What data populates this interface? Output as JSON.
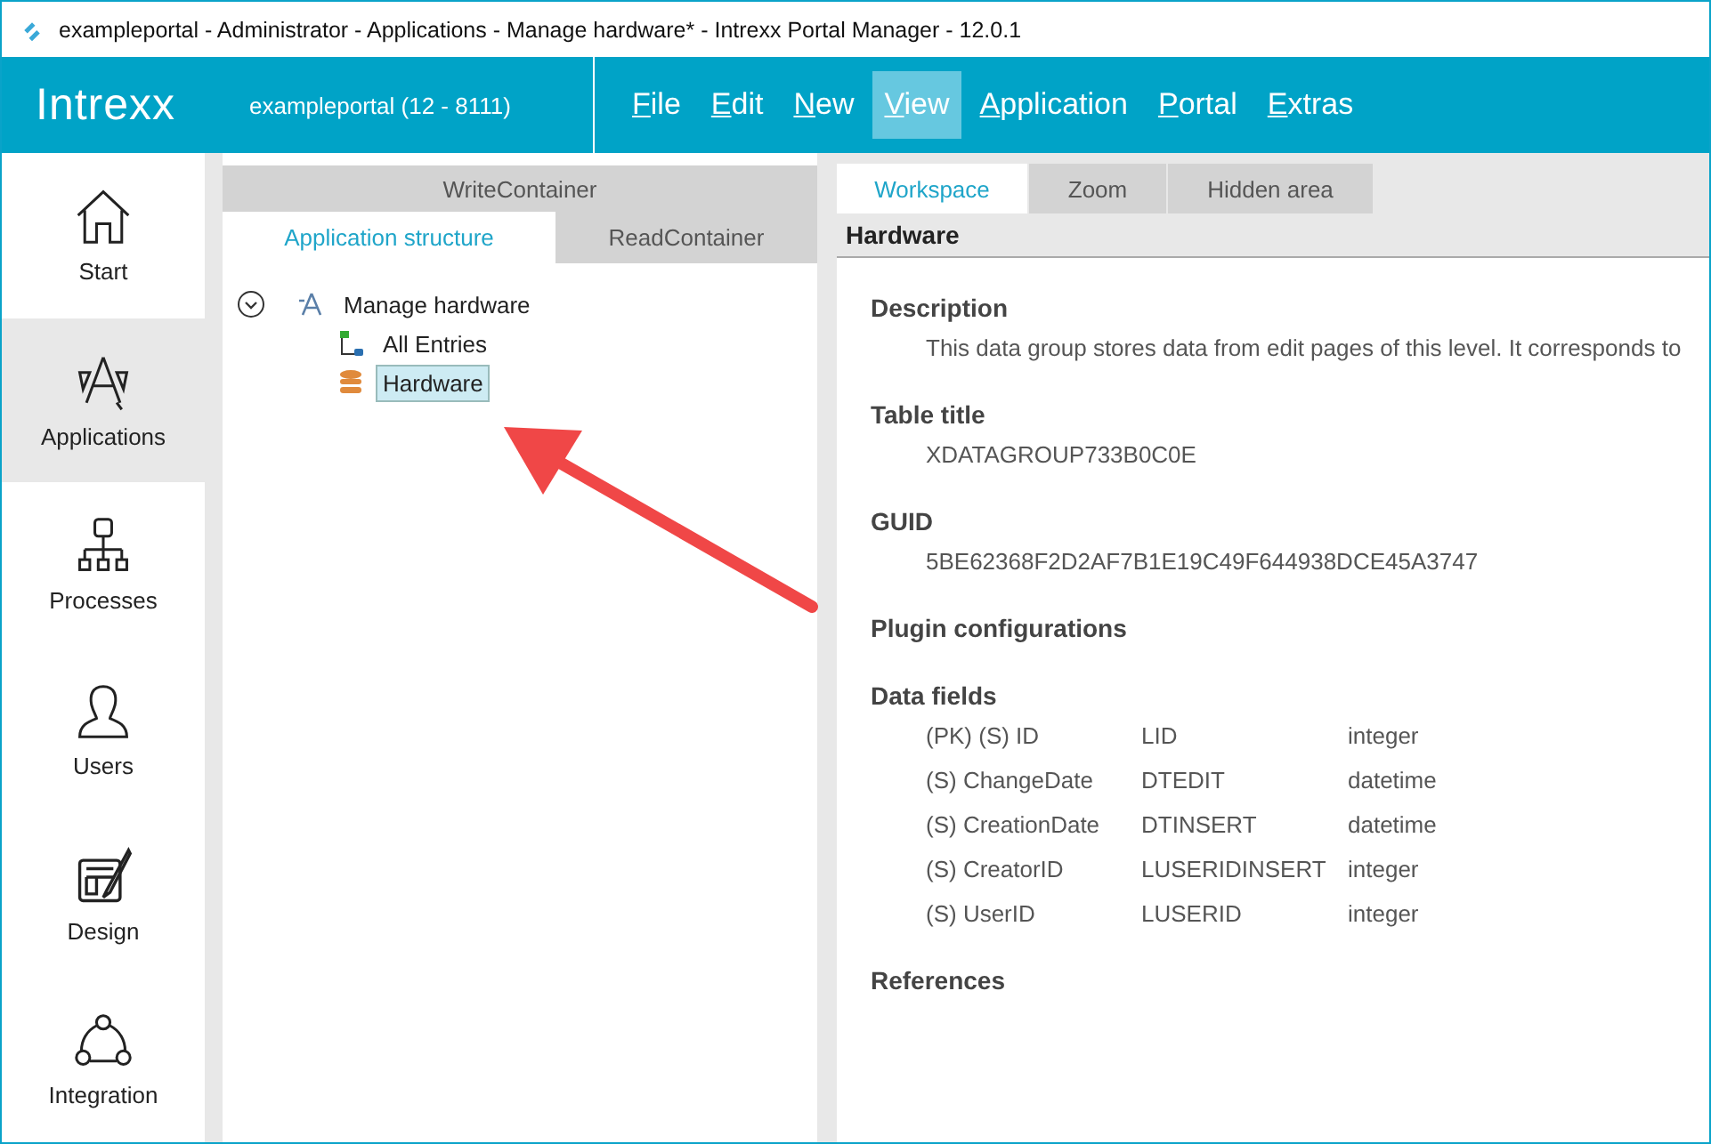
{
  "window": {
    "title": "exampleportal - Administrator - Applications - Manage hardware* - Intrexx Portal Manager - 12.0.1"
  },
  "header": {
    "logo": "Intrexx",
    "portal": "exampleportal (12 - 8111)"
  },
  "menu": [
    {
      "label": "File",
      "selected": false
    },
    {
      "label": "Edit",
      "selected": false
    },
    {
      "label": "New",
      "selected": false
    },
    {
      "label": "View",
      "selected": true
    },
    {
      "label": "Application",
      "selected": false
    },
    {
      "label": "Portal",
      "selected": false
    },
    {
      "label": "Extras",
      "selected": false
    }
  ],
  "sidebar": {
    "items": [
      {
        "label": "Start",
        "kind": "home",
        "selected": false
      },
      {
        "label": "Applications",
        "kind": "applications",
        "selected": true
      },
      {
        "label": "Processes",
        "kind": "processes",
        "selected": false
      },
      {
        "label": "Users",
        "kind": "users",
        "selected": false
      },
      {
        "label": "Design",
        "kind": "design",
        "selected": false
      },
      {
        "label": "Integration",
        "kind": "integration",
        "selected": false
      }
    ]
  },
  "left_panel": {
    "top_tab": "WriteContainer",
    "tabs": [
      {
        "label": "Application structure",
        "selected": true
      },
      {
        "label": "ReadContainer",
        "selected": false
      }
    ],
    "tree": [
      {
        "label": "Manage hardware",
        "kind": "application",
        "expanded": true,
        "selected": false,
        "children": [
          {
            "label": "All Entries",
            "kind": "page",
            "selected": false
          },
          {
            "label": "Hardware",
            "kind": "datagroup",
            "selected": true
          }
        ]
      }
    ]
  },
  "right_panel": {
    "tabs": [
      {
        "label": "Workspace",
        "selected": true
      },
      {
        "label": "Zoom",
        "selected": false
      },
      {
        "label": "Hidden area",
        "selected": false
      }
    ],
    "title": "Hardware",
    "sections": [
      {
        "heading": "Description",
        "value": "This data group stores data from edit pages of this level. It corresponds to"
      },
      {
        "heading": "Table title",
        "value": "XDATAGROUP733B0C0E"
      },
      {
        "heading": "GUID",
        "value": "5BE62368F2D2AF7B1E19C49F644938DCE45A3747"
      },
      {
        "heading": "Plugin configurations"
      }
    ],
    "data_fields": {
      "heading": "Data fields",
      "rows": [
        {
          "name": "(PK) (S) ID",
          "column": "LID",
          "type": "integer"
        },
        {
          "name": "(S) ChangeDate",
          "column": "DTEDIT",
          "type": "datetime"
        },
        {
          "name": "(S) CreationDate",
          "column": "DTINSERT",
          "type": "datetime"
        },
        {
          "name": "(S) CreatorID",
          "column": "LUSERIDINSERT",
          "type": "integer"
        },
        {
          "name": "(S) UserID",
          "column": "LUSERID",
          "type": "integer"
        }
      ]
    },
    "references": {
      "heading": "References"
    }
  }
}
